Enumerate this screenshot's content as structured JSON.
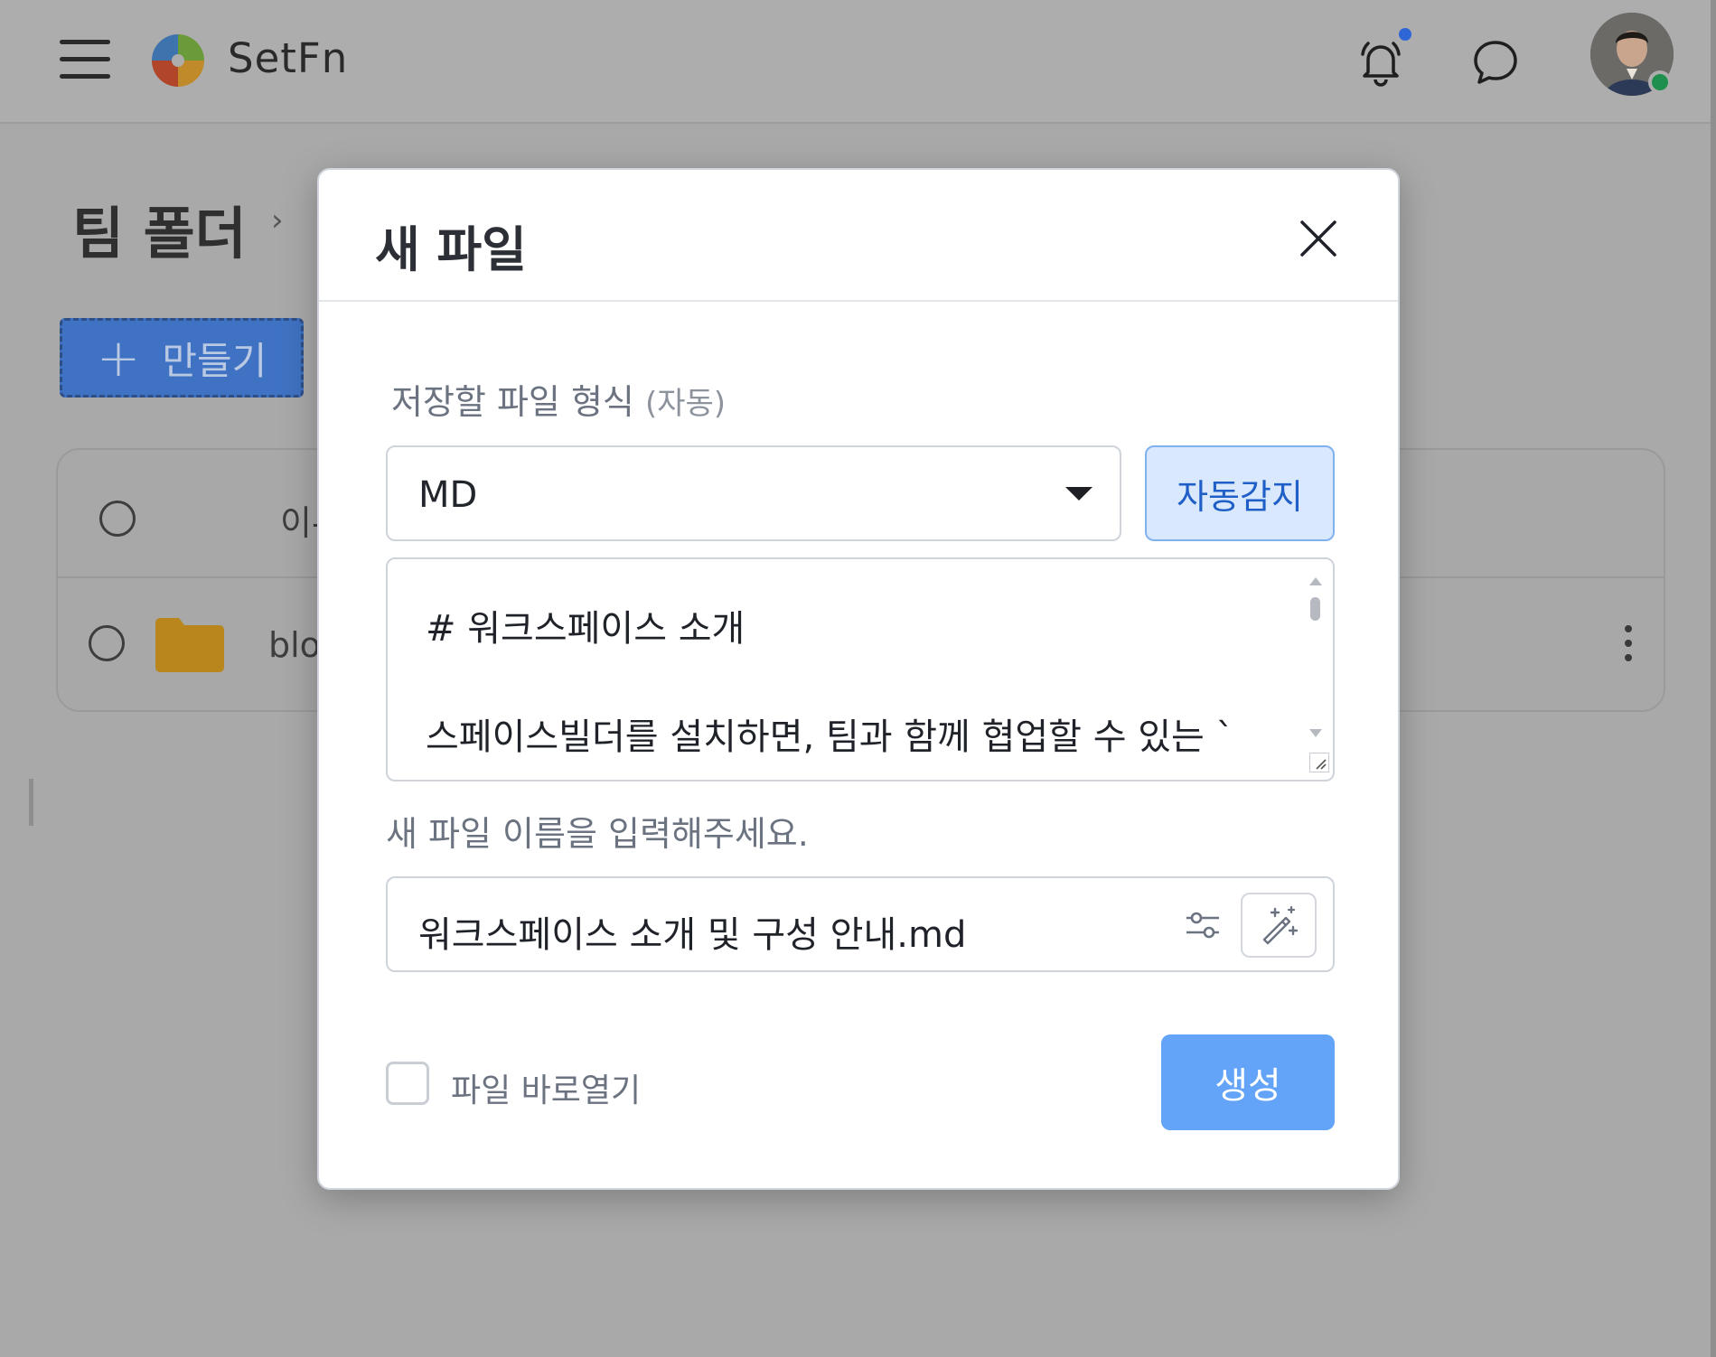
{
  "header": {
    "brand": "SetFn",
    "notification_dot_color": "#2e66d6",
    "avatar_status_color": "#1f8f4e"
  },
  "page": {
    "title": "팀 폴더",
    "breadcrumb_separator": "›",
    "create_button_label": "만들기",
    "table": {
      "header_name_partial": "이-",
      "rows": [
        {
          "name_partial": "blo",
          "icon": "folder-icon"
        }
      ]
    }
  },
  "modal": {
    "title": "새 파일",
    "format_label": "저장할 파일 형식",
    "format_label_suffix": "(자동)",
    "format_selected": "MD",
    "auto_detect_label": "자동감지",
    "content_lines": [
      "# 워크스페이스 소개",
      "스페이스빌더를 설치하면, 팀과 함께 협업할 수 있는 `"
    ],
    "name_label": "새 파일 이름을 입력해주세요.",
    "file_name_value": "워크스페이스 소개 및 구성 안내.md",
    "open_file_checkbox_label": "파일 바로열기",
    "open_file_checked": false,
    "generate_button_label": "생성",
    "accent_color": "#63a4f8"
  }
}
